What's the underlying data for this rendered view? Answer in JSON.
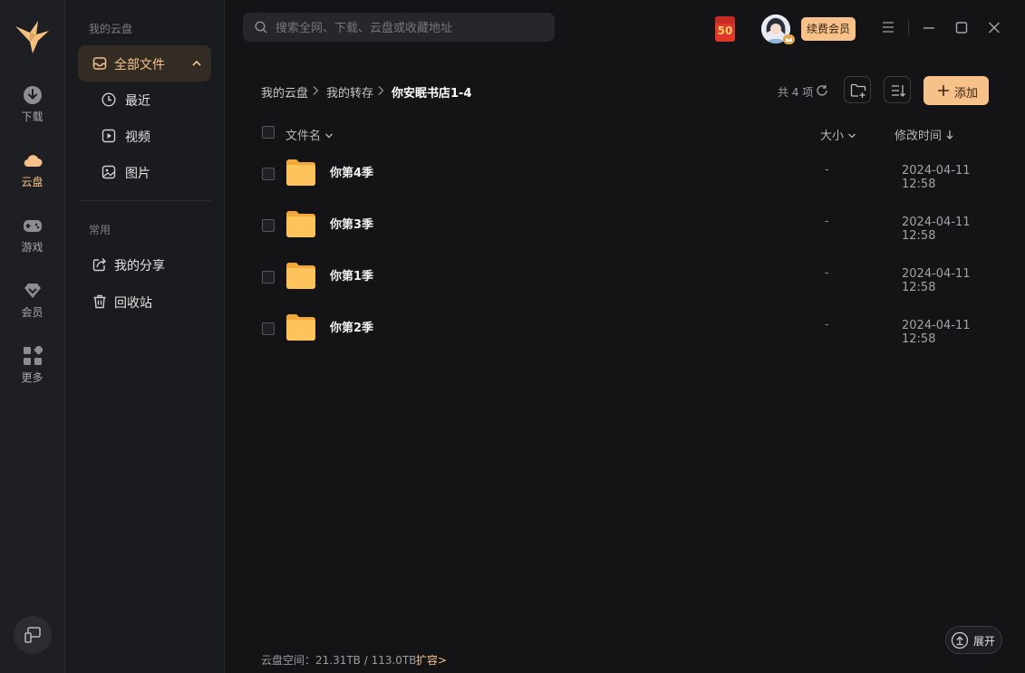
{
  "rail": {
    "items": [
      {
        "label": "下载",
        "icon": "download-icon"
      },
      {
        "label": "云盘",
        "icon": "cloud-icon"
      },
      {
        "label": "游戏",
        "icon": "gamepad-icon"
      },
      {
        "label": "会员",
        "icon": "diamond-icon"
      },
      {
        "label": "更多",
        "icon": "grid-icon"
      }
    ]
  },
  "sidebar": {
    "title": "我的云盘",
    "all_files": "全部文件",
    "sub": [
      {
        "label": "最近",
        "icon": "clock-icon"
      },
      {
        "label": "视频",
        "icon": "video-icon"
      },
      {
        "label": "图片",
        "icon": "image-icon"
      }
    ],
    "common_title": "常用",
    "common": [
      {
        "label": "我的分享",
        "icon": "share-icon"
      },
      {
        "label": "回收站",
        "icon": "trash-icon"
      }
    ]
  },
  "search": {
    "placeholder": "搜索全网、下载、云盘或收藏地址"
  },
  "topbar": {
    "coupon": "50",
    "vip_label": "续费会员"
  },
  "breadcrumb": [
    "我的云盘",
    "我的转存",
    "你安眠书店1-4"
  ],
  "count_text": "共 4 项",
  "add_label": "添加",
  "table": {
    "col_name": "文件名",
    "col_size": "大小",
    "col_modified": "修改时间",
    "rows": [
      {
        "name": "你第4季",
        "size": "-",
        "modified": "2024-04-11 12:58"
      },
      {
        "name": "你第3季",
        "size": "-",
        "modified": "2024-04-11 12:58"
      },
      {
        "name": "你第1季",
        "size": "-",
        "modified": "2024-04-11 12:58"
      },
      {
        "name": "你第2季",
        "size": "-",
        "modified": "2024-04-11 12:58"
      }
    ]
  },
  "footer": {
    "storage": "云盘空间：21.31TB / 113.0TB",
    "expand": "扩容>",
    "collapse_btn": "展开"
  },
  "colors": {
    "accent": "#f7c28a",
    "folder": "#ffc35b",
    "bg": "#141416"
  }
}
